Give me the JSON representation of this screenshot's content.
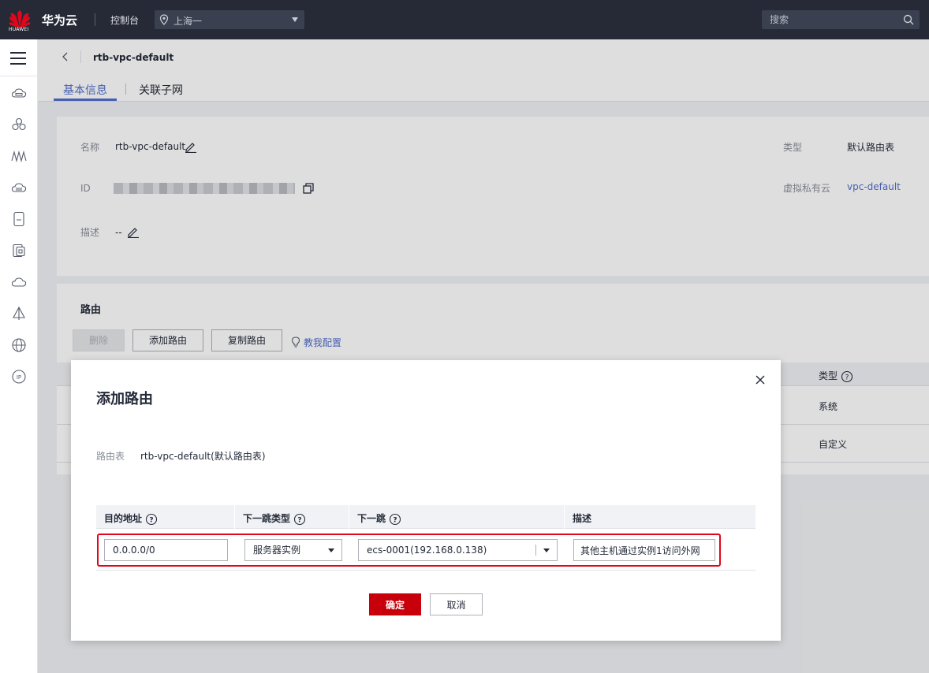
{
  "topbar": {
    "logo_text": "HUAWEI",
    "brand": "华为云",
    "console": "控制台",
    "region": "上海一",
    "search_placeholder": "搜索"
  },
  "sidebar": {
    "icons": [
      "menu-icon",
      "cloud-server-icon",
      "cluster-icon",
      "network-icon",
      "storage-icon",
      "database-icon",
      "security-icon",
      "cloud-icon",
      "vpn-icon",
      "globe-icon",
      "ip-icon"
    ]
  },
  "header": {
    "title": "rtb-vpc-default",
    "tabs": [
      {
        "label": "基本信息",
        "active": true
      },
      {
        "label": "关联子网",
        "active": false
      }
    ]
  },
  "info": {
    "name_label": "名称",
    "name_value": "rtb-vpc-default",
    "id_label": "ID",
    "desc_label": "描述",
    "desc_value": "--",
    "type_label": "类型",
    "type_value": "默认路由表",
    "vpc_label": "虚拟私有云",
    "vpc_value": "vpc-default"
  },
  "routes": {
    "title": "路由",
    "delete_label": "删除",
    "add_label": "添加路由",
    "copy_label": "复制路由",
    "teach_label": "教我配置",
    "type_header": "类型",
    "rows": [
      {
        "type": "系统"
      },
      {
        "type": "自定义"
      }
    ]
  },
  "modal": {
    "title": "添加路由",
    "route_table_label": "路由表",
    "route_table_value": "rtb-vpc-default(默认路由表)",
    "columns": [
      "目的地址",
      "下一跳类型",
      "下一跳",
      "描述"
    ],
    "destination": "0.0.0.0/0",
    "next_hop_type": "服务器实例",
    "next_hop": "ecs-0001(192.168.0.138)",
    "description": "其他主机通过实例1访问外网",
    "ok_label": "确定",
    "cancel_label": "取消"
  },
  "colors": {
    "topbar_bg": "#252a36",
    "accent": "#526ecc",
    "primary_button": "#c7000b",
    "highlight_border": "#e0061b"
  }
}
